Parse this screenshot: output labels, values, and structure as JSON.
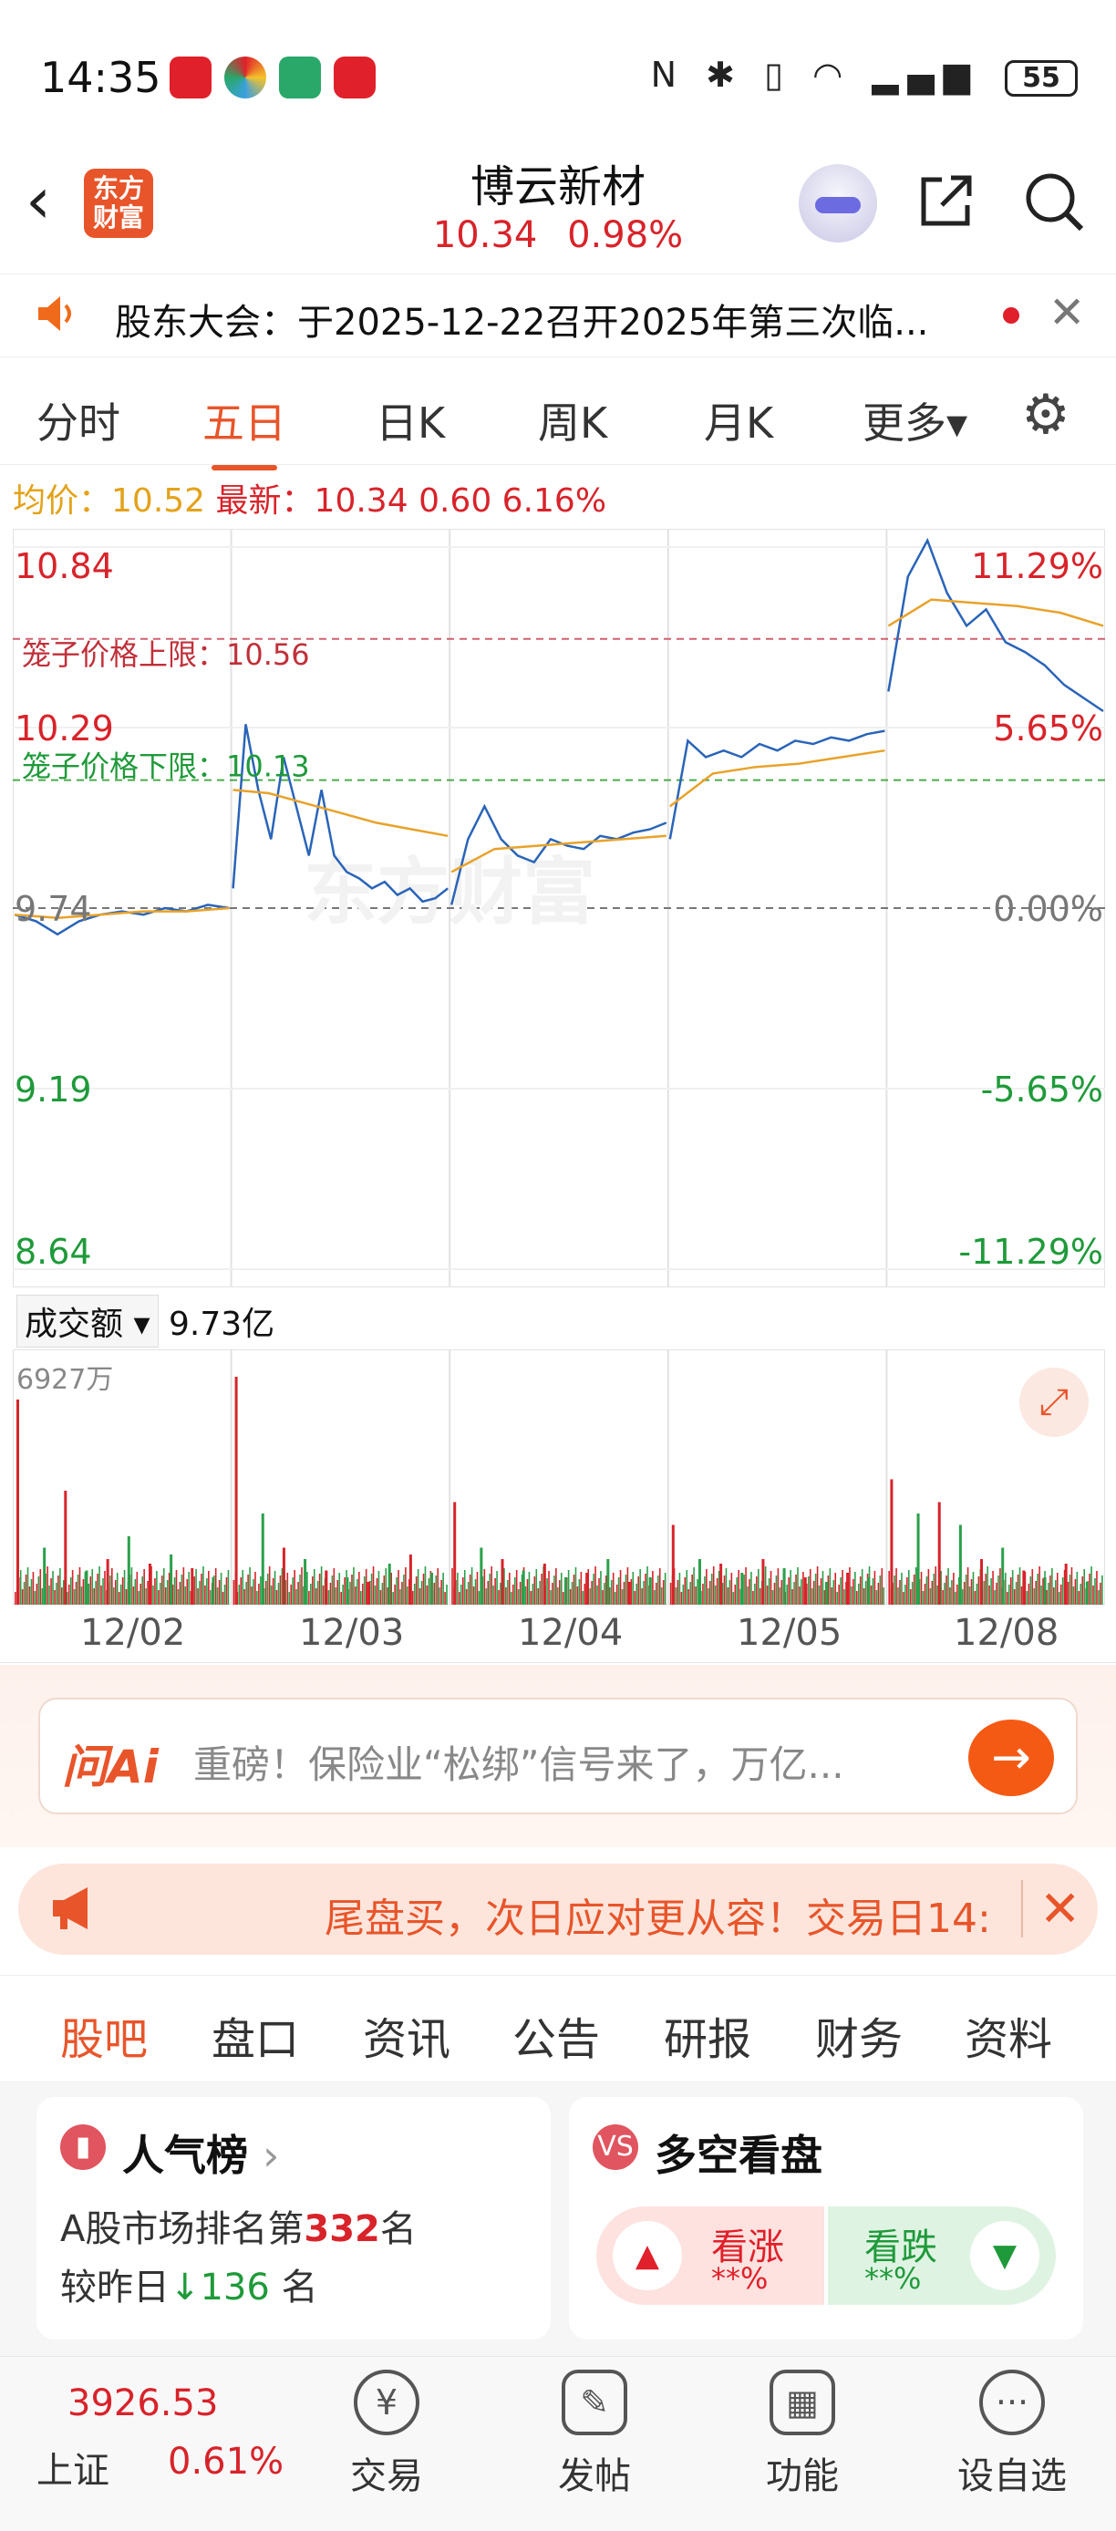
{
  "status_bar": {
    "time": "14:35",
    "battery": "55",
    "app_icon_colors": [
      "#e0202a",
      "#3aa0e0",
      "#2aa86a",
      "#e0202a"
    ],
    "system_icons": "N ✱ ▯ ◠ ▂▄▆"
  },
  "header": {
    "logo_text": "东方\n财富",
    "stock_name": "博云新材",
    "price": "10.34",
    "change_pct": "0.98%"
  },
  "notice": {
    "text": "股东大会：于2025-12-22召开2025年第三次临..."
  },
  "chart_tabs": [
    "分时",
    "五日",
    "日K",
    "周K",
    "月K",
    "更多▾"
  ],
  "active_chart_tab": 1,
  "info": {
    "avg_label": "均价：",
    "avg_value": "10.52",
    "latest_label": "最新：",
    "latest_value": "10.34",
    "change": "0.60",
    "change_pct": "6.16%"
  },
  "chart_data": {
    "type": "line",
    "title": "",
    "x_days": [
      "12/02",
      "12/03",
      "12/04",
      "12/05",
      "12/08"
    ],
    "ylim": [
      8.64,
      10.84
    ],
    "prev_close": 9.74,
    "y_left_labels": [
      "10.84",
      "10.29",
      "9.74",
      "9.19",
      "8.64"
    ],
    "y_right_labels": [
      "11.29%",
      "5.65%",
      "0.00%",
      "-5.65%",
      "-11.29%"
    ],
    "cage_upper_label": "笼子价格上限：",
    "cage_upper": "10.56",
    "cage_lower_label": "笼子价格下限：",
    "cage_lower": "10.13",
    "watermark": "东方财富",
    "price_color": "#2a64b8",
    "avg_color": "#e8a22a",
    "series": [
      {
        "name": "最新",
        "day_points": [
          [
            9.72,
            9.7,
            9.66,
            9.7,
            9.72,
            9.73,
            9.72,
            9.74,
            9.73,
            9.75,
            9.74
          ],
          [
            9.8,
            10.3,
            10.1,
            9.95,
            10.2,
            10.05,
            9.9,
            10.1,
            9.9,
            9.85,
            9.83,
            9.8,
            9.82,
            9.78,
            9.8,
            9.76,
            9.77,
            9.8
          ],
          [
            9.75,
            9.95,
            10.05,
            9.95,
            9.9,
            9.88,
            9.95,
            9.93,
            9.92,
            9.96,
            9.95,
            9.97,
            9.98,
            10.0
          ],
          [
            9.95,
            10.25,
            10.2,
            10.22,
            10.2,
            10.24,
            10.22,
            10.25,
            10.24,
            10.26,
            10.25,
            10.27,
            10.28
          ],
          [
            10.4,
            10.75,
            10.86,
            10.7,
            10.6,
            10.65,
            10.55,
            10.52,
            10.48,
            10.42,
            10.38,
            10.34
          ]
        ]
      },
      {
        "name": "均价",
        "day_points": [
          [
            9.72,
            9.71,
            9.72,
            9.73,
            9.73,
            9.74
          ],
          [
            10.1,
            10.09,
            10.06,
            10.03,
            10.0,
            9.98,
            9.96
          ],
          [
            9.85,
            9.92,
            9.93,
            9.94,
            9.95,
            9.96
          ],
          [
            10.05,
            10.15,
            10.17,
            10.18,
            10.2,
            10.22
          ],
          [
            10.6,
            10.68,
            10.67,
            10.66,
            10.64,
            10.6
          ]
        ]
      }
    ],
    "volume": {
      "label": "成交额",
      "total": "9.73亿",
      "max_label": "6927万",
      "spikes": [
        [
          0.9,
          0.25,
          0.5,
          0.15,
          0.2,
          0.3,
          0.18,
          0.22,
          0.16,
          0.12
        ],
        [
          1.0,
          0.4,
          0.25,
          0.2,
          0.15,
          0.12,
          0.1,
          0.18,
          0.22,
          0.14
        ],
        [
          0.45,
          0.25,
          0.2,
          0.15,
          0.18,
          0.12,
          0.14,
          0.2,
          0.1,
          0.12
        ],
        [
          0.35,
          0.2,
          0.18,
          0.14,
          0.2,
          0.16,
          0.12,
          0.1,
          0.14,
          0.12
        ],
        [
          0.55,
          0.4,
          0.45,
          0.35,
          0.2,
          0.25,
          0.15,
          0.12,
          0.18,
          0.1
        ]
      ]
    }
  },
  "ai_box": {
    "logo": "问Ai",
    "text": "重磅！保险业“松绑”信号来了，万亿..."
  },
  "promo": {
    "text": "尾盘买，次日应对更从容！交易日14:"
  },
  "section_tabs": [
    "股吧",
    "盘口",
    "资讯",
    "公告",
    "研报",
    "财务",
    "资料"
  ],
  "active_section_tab": 0,
  "popularity_card": {
    "title": "人气榜",
    "rank_prefix": "A股市场排名第",
    "rank": "332",
    "rank_suffix": "名",
    "change_prefix": "较昨日",
    "change_arrow": "↓",
    "change": "136",
    "change_suffix": "名"
  },
  "sentiment_card": {
    "title": "多空看盘",
    "bull_label": "看涨",
    "bull_value": "**%",
    "bear_label": "看跌",
    "bear_value": "**%"
  },
  "bottom_nav": {
    "index_value": "3926.53",
    "index_name": "上证",
    "index_change": "0.61%",
    "items": [
      {
        "label": "交易",
        "icon": "yen-icon"
      },
      {
        "label": "发帖",
        "icon": "edit-icon"
      },
      {
        "label": "功能",
        "icon": "grid-icon"
      },
      {
        "label": "设自选",
        "icon": "more-icon"
      }
    ]
  }
}
